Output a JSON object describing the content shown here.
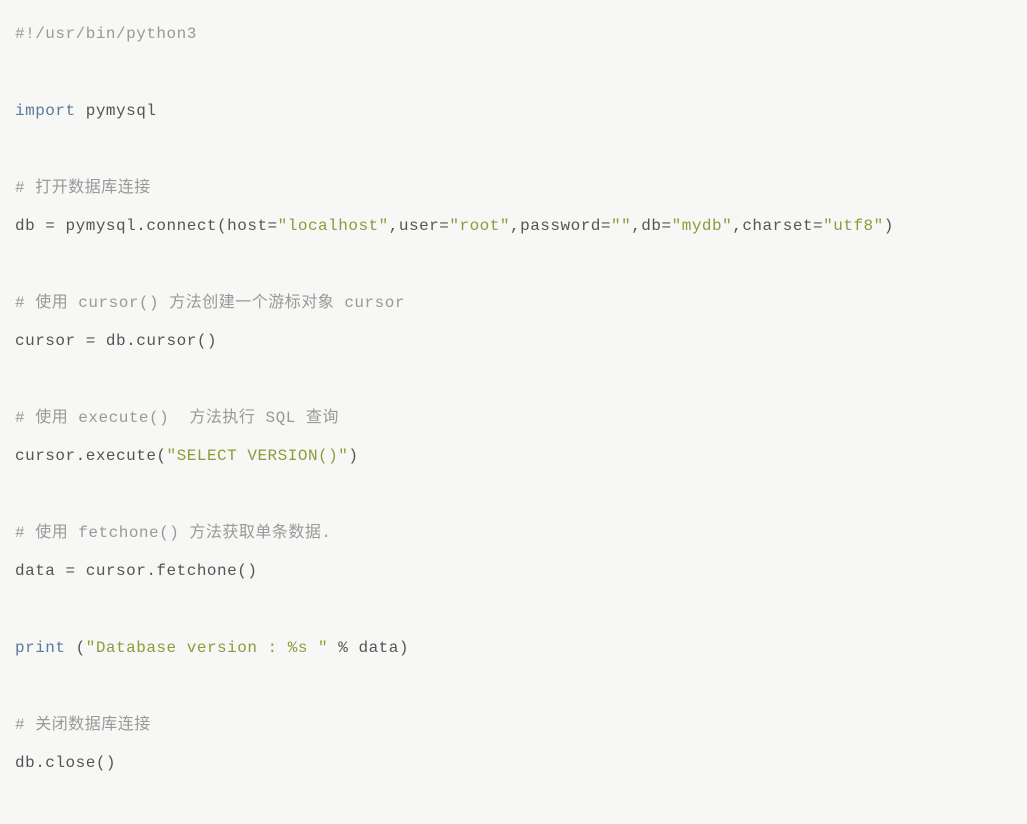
{
  "code": {
    "line1": {
      "comment": "#!/usr/bin/python3"
    },
    "line2": {
      "keyword": "import",
      "text": " pymysql"
    },
    "line3": {
      "comment": "# 打开数据库连接"
    },
    "line4": {
      "part1": "db = pymysql.connect(host=",
      "str1": "\"localhost\"",
      "part2": ",user=",
      "str2": "\"root\"",
      "part3": ",password=",
      "str3": "\"\"",
      "part4": ",db=",
      "str4": "\"mydb\"",
      "part5": ",charset=",
      "str5": "\"utf8\"",
      "part6": ")"
    },
    "line5": {
      "comment": "# 使用 cursor() 方法创建一个游标对象 cursor"
    },
    "line6": {
      "text": "cursor = db.cursor()"
    },
    "line7": {
      "comment": "# 使用 execute()  方法执行 SQL 查询"
    },
    "line8": {
      "part1": "cursor.execute(",
      "str1": "\"SELECT VERSION()\"",
      "part2": ")"
    },
    "line9": {
      "comment": "# 使用 fetchone() 方法获取单条数据."
    },
    "line10": {
      "text": "data = cursor.fetchone()"
    },
    "line11": {
      "keyword": "print",
      "part1": " (",
      "str1": "\"Database version : %s \"",
      "part2": " % data)"
    },
    "line12": {
      "comment": "# 关闭数据库连接"
    },
    "line13": {
      "text": "db.close()"
    }
  }
}
